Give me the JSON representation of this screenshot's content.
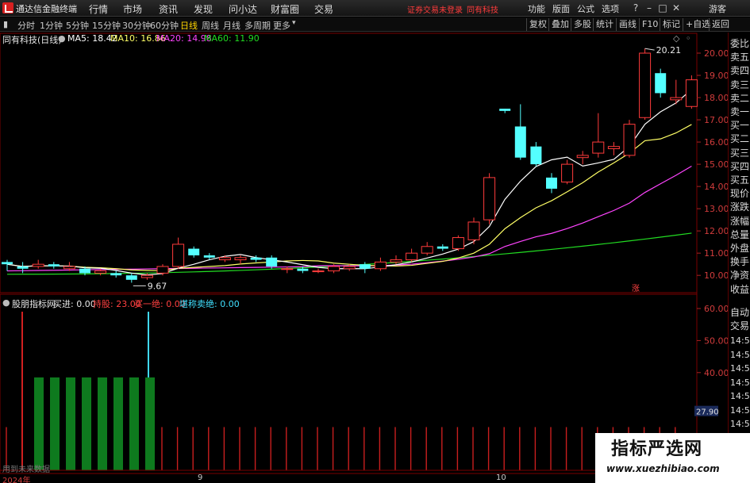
{
  "menubar": {
    "app_title": "通达信金融终端",
    "items": [
      "行情",
      "市场",
      "资讯",
      "发现",
      "问小达",
      "财富圈",
      "交易"
    ],
    "warning": "证券交易未登录",
    "stock_name": "同有科技",
    "right_items": [
      "功能",
      "版面",
      "公式",
      "选项"
    ],
    "guest": "游客"
  },
  "toolbar": {
    "periods": [
      "分时",
      "1分钟",
      "5分钟",
      "15分钟",
      "30分钟",
      "60分钟",
      "日线",
      "周线",
      "月线",
      "多周期",
      "更多"
    ],
    "active_period": "日线",
    "right_buttons": [
      "复权",
      "叠加",
      "多股",
      "统计",
      "画线",
      "F10",
      "标记",
      "+自选",
      "返回"
    ]
  },
  "ma_legend": {
    "title": "同有科技(日线)",
    "ma5": "MA5: 18.42",
    "ma10": "MA10: 16.86",
    "ma20": "MA20: 14.98",
    "ma60": "MA60: 11.90",
    "colors": {
      "ma5": "#ffffff",
      "ma10": "#ffff66",
      "ma20": "#ff44ff",
      "ma60": "#22dd22"
    }
  },
  "price_axis": {
    "labels": [
      "20.00",
      "19.00",
      "18.00",
      "17.00",
      "16.00",
      "15.00",
      "14.00",
      "13.00",
      "12.00",
      "11.00",
      "10.00"
    ]
  },
  "annotations": {
    "high": "20.21",
    "low": "9.67",
    "rise_badge": "涨"
  },
  "indicator": {
    "name": "股朋指标网",
    "buy": "买进: 0.00",
    "hold": "持股: 23.00",
    "sell_one": "买一绝: 0.00",
    "sell_two": "堪称卖绝: 0.00",
    "axis_labels": [
      "60.00",
      "50.00",
      "40.00",
      "20.00"
    ],
    "current_value": "27.90"
  },
  "x_axis": {
    "labels": [
      "2024年",
      "9",
      "10"
    ]
  },
  "side_column": {
    "items": [
      "委比",
      "卖五",
      "卖四",
      "卖三",
      "卖二",
      "卖一",
      "买一",
      "买二",
      "买三",
      "买四",
      "买五",
      "现价",
      "涨跌",
      "涨幅",
      "总量",
      "外盘",
      "换手",
      "净资",
      "收益"
    ],
    "lower_items": [
      "自动",
      "交易"
    ],
    "times": [
      "14:56",
      "14:56",
      "14:56",
      "14:56",
      "14:56",
      "14:56",
      "14:56",
      "14:56"
    ]
  },
  "watermark": {
    "title": "指标严选网",
    "url": "www.xuezhibiao.com"
  },
  "bottom_note": "用到未来数据",
  "chart_data": {
    "type": "candlestick",
    "candles": [
      [
        10.6,
        10.5,
        10.7,
        10.2
      ],
      [
        10.4,
        10.3,
        10.6,
        10.1
      ],
      [
        10.4,
        10.5,
        10.7,
        10.3
      ],
      [
        10.5,
        10.4,
        10.6,
        10.3
      ],
      [
        10.3,
        10.4,
        10.6,
        10.2
      ],
      [
        10.3,
        10.1,
        10.4,
        10.0
      ],
      [
        10.1,
        10.2,
        10.3,
        10.0
      ],
      [
        10.1,
        10.0,
        10.2,
        9.9
      ],
      [
        10.0,
        9.8,
        10.1,
        9.67
      ],
      [
        9.9,
        10.0,
        10.1,
        9.8
      ],
      [
        10.1,
        10.4,
        10.5,
        10.0
      ],
      [
        10.4,
        11.4,
        11.7,
        10.3
      ],
      [
        11.2,
        10.9,
        11.3,
        10.8
      ],
      [
        10.9,
        10.8,
        11.0,
        10.7
      ],
      [
        10.7,
        10.8,
        10.9,
        10.6
      ],
      [
        10.7,
        10.8,
        10.9,
        10.5
      ],
      [
        10.8,
        10.7,
        10.9,
        10.6
      ],
      [
        10.8,
        10.4,
        10.9,
        10.3
      ],
      [
        10.3,
        10.3,
        10.4,
        10.1
      ],
      [
        10.3,
        10.2,
        10.4,
        10.1
      ],
      [
        10.2,
        10.2,
        10.3,
        10.1
      ],
      [
        10.2,
        10.4,
        10.5,
        10.1
      ],
      [
        10.3,
        10.4,
        10.5,
        10.2
      ],
      [
        10.5,
        10.3,
        10.6,
        10.1
      ],
      [
        10.3,
        10.6,
        10.8,
        10.2
      ],
      [
        10.6,
        10.7,
        10.9,
        10.5
      ],
      [
        10.7,
        11.0,
        11.2,
        10.6
      ],
      [
        11.0,
        11.3,
        11.5,
        10.9
      ],
      [
        11.3,
        11.2,
        11.4,
        11.1
      ],
      [
        11.2,
        11.7,
        11.8,
        11.1
      ],
      [
        11.6,
        12.4,
        12.6,
        11.4
      ],
      [
        12.5,
        14.4,
        14.6,
        12.3
      ],
      [
        17.5,
        17.4,
        17.5,
        17.3
      ],
      [
        16.7,
        15.3,
        17.7,
        15.2
      ],
      [
        15.8,
        15.0,
        16.0,
        14.9
      ],
      [
        14.4,
        13.9,
        14.6,
        13.7
      ],
      [
        14.2,
        15.0,
        15.2,
        14.1
      ],
      [
        15.3,
        15.4,
        15.6,
        15.0
      ],
      [
        15.5,
        16.0,
        17.3,
        15.3
      ],
      [
        15.7,
        15.8,
        16.0,
        15.4
      ],
      [
        15.4,
        16.8,
        17.0,
        15.3
      ],
      [
        17.1,
        20.0,
        20.21,
        17.0
      ],
      [
        19.1,
        18.2,
        19.3,
        18.0
      ],
      [
        17.9,
        18.0,
        18.8,
        17.7
      ],
      [
        17.6,
        18.8,
        19.0,
        17.5
      ]
    ],
    "price_range": [
      9.4,
      20.5
    ],
    "x_labels": [
      "2024年",
      "9",
      "10"
    ]
  }
}
